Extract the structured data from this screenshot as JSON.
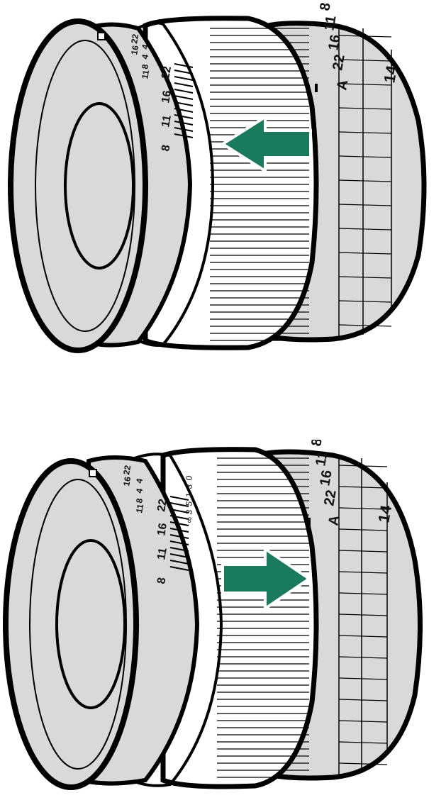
{
  "colors": {
    "arrow": "#1a7a5e",
    "body": "#d9d9d9",
    "outline": "#000000"
  },
  "lens_pull": {
    "aperture_scale": [
      "16",
      "22",
      "11",
      "8",
      "4",
      "4",
      "8",
      "11",
      "16",
      "22"
    ],
    "aperture_ring": [
      "A",
      "22",
      "16",
      "11",
      "8"
    ],
    "focal_mark": "14",
    "arrow": "left-arrow-icon"
  },
  "lens_push": {
    "aperture_scale": [
      "16",
      "22",
      "11",
      "8",
      "4",
      "4",
      "8",
      "11",
      "16",
      "22"
    ],
    "distance_scale": [
      "∞",
      "3",
      "5",
      "1",
      "3",
      "0"
    ],
    "aperture_ring": [
      "A",
      "22",
      "16",
      "11",
      "8"
    ],
    "focal_mark": "14",
    "arrow": "right-arrow-icon"
  }
}
